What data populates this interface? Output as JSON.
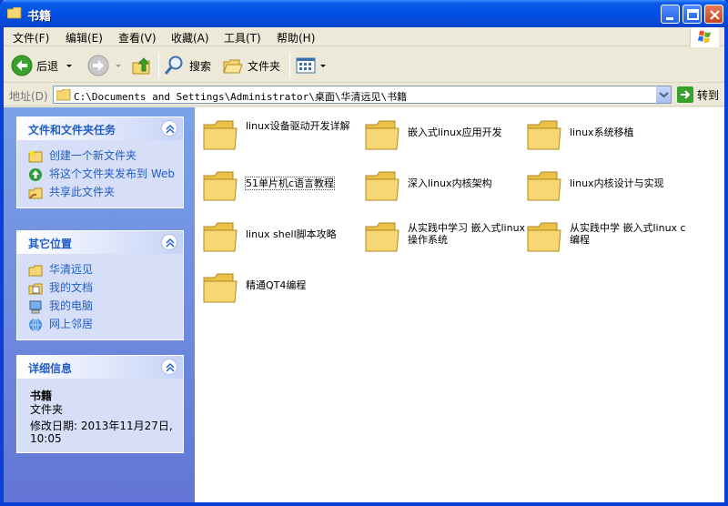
{
  "window": {
    "title": "书籍"
  },
  "menu": [
    "文件(F)",
    "编辑(E)",
    "查看(V)",
    "收藏(A)",
    "工具(T)",
    "帮助(H)"
  ],
  "toolbar": {
    "back_label": "后退",
    "search_label": "搜索",
    "folders_label": "文件夹"
  },
  "address": {
    "label": "地址(D)",
    "path": "C:\\Documents and Settings\\Administrator\\桌面\\华清远见\\书籍",
    "go_label": "转到"
  },
  "tasks": {
    "title": "文件和文件夹任务",
    "items": [
      {
        "label": "创建一个新文件夹",
        "icon": "new-folder-icon"
      },
      {
        "label": "将这个文件夹发布到 Web",
        "icon": "publish-web-icon"
      },
      {
        "label": "共享此文件夹",
        "icon": "share-folder-icon"
      }
    ]
  },
  "places": {
    "title": "其它位置",
    "items": [
      {
        "label": "华清远见",
        "icon": "folder-icon"
      },
      {
        "label": "我的文档",
        "icon": "my-documents-icon"
      },
      {
        "label": "我的电脑",
        "icon": "my-computer-icon"
      },
      {
        "label": "网上邻居",
        "icon": "network-icon"
      }
    ]
  },
  "details": {
    "title": "详细信息",
    "name": "书籍",
    "type": "文件夹",
    "modified": "修改日期: 2013年11月27日, 10:05"
  },
  "folders": [
    "linux设备驱动开发详解",
    "嵌入式linux应用开发",
    "linux系统移植",
    "51单片机c语言教程",
    "深入linux内核架构",
    "linux内核设计与实现",
    "linux shell脚本攻略",
    "从实践中学习 嵌入式linux操作系统",
    "从实践中学 嵌入式linux c编程",
    "精通QT4编程"
  ],
  "colors": {
    "title_bar": "#0050e6",
    "left_pane": "#7ba2e7",
    "link": "#215dc6",
    "folder": "#f7d774"
  }
}
